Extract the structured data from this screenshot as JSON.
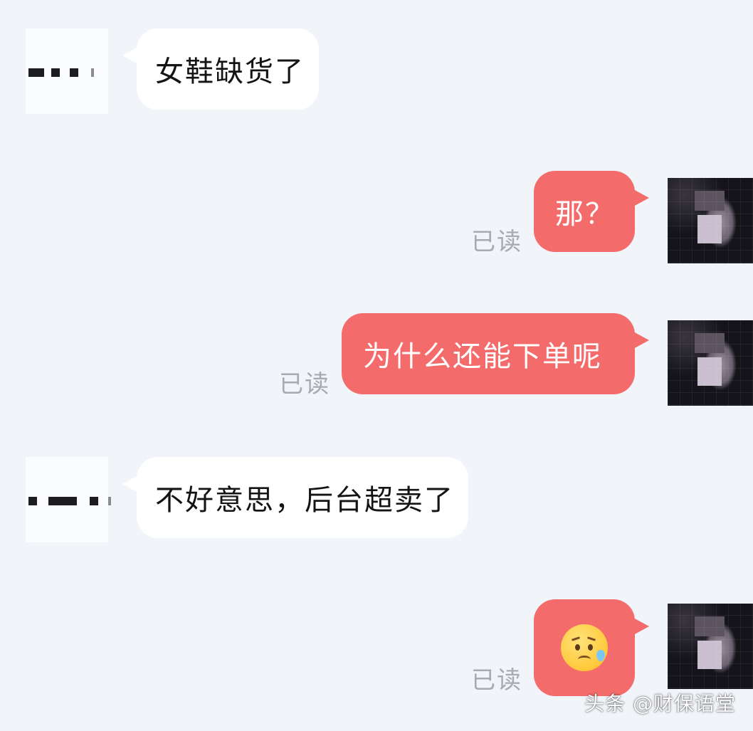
{
  "messages": [
    {
      "side": "incoming",
      "text": "女鞋缺货了"
    },
    {
      "side": "outgoing",
      "text": "那？",
      "status": "已读"
    },
    {
      "side": "outgoing",
      "text": "为什么还能下单呢",
      "status": "已读"
    },
    {
      "side": "incoming",
      "text": "不好意思，后台超卖了"
    },
    {
      "side": "outgoing",
      "emoji": "sad-but-relieved-face-emoji",
      "status": "已读"
    }
  ],
  "watermark": "头条 @财保语堂",
  "colors": {
    "background": "#f1f4f9",
    "incoming_bubble": "#ffffff",
    "outgoing_bubble": "#f46b6b",
    "read_label": "#a7aaae"
  }
}
